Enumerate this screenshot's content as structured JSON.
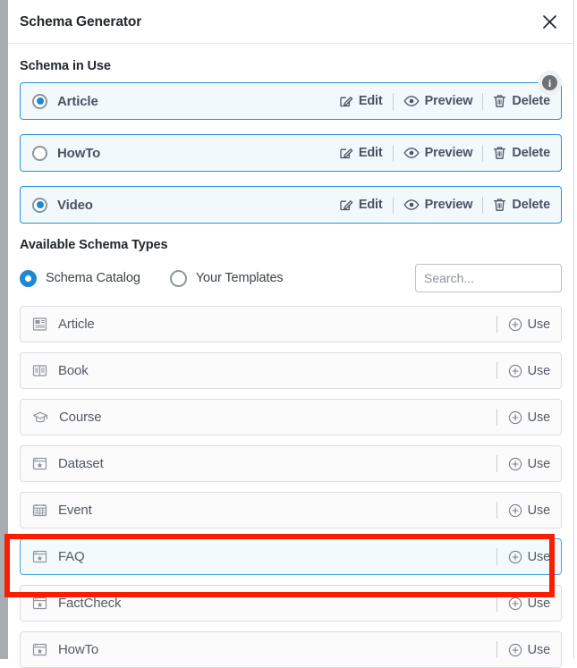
{
  "modal": {
    "title": "Schema Generator",
    "close_icon": "close-icon"
  },
  "schema_in_use": {
    "title": "Schema in Use",
    "info_icon": "info-icon",
    "info_glyph": "i",
    "action_labels": {
      "edit": "Edit",
      "preview": "Preview",
      "delete": "Delete"
    },
    "rows": [
      {
        "name": "Article",
        "selected": true
      },
      {
        "name": "HowTo",
        "selected": false
      },
      {
        "name": "Video",
        "selected": true
      }
    ]
  },
  "available_schema_types": {
    "title": "Available Schema Types",
    "filters": [
      {
        "label": "Schema Catalog",
        "selected": true
      },
      {
        "label": "Your Templates",
        "selected": false
      }
    ],
    "search": {
      "placeholder": "Search...",
      "value": ""
    },
    "use_label": "Use",
    "items": [
      {
        "name": "Article",
        "icon": "newspaper-icon",
        "highlighted": false
      },
      {
        "name": "Book",
        "icon": "open-book-icon",
        "highlighted": false
      },
      {
        "name": "Course",
        "icon": "graduation-cap-icon",
        "highlighted": false
      },
      {
        "name": "Dataset",
        "icon": "window-star-icon",
        "highlighted": false
      },
      {
        "name": "Event",
        "icon": "calendar-grid-icon",
        "highlighted": false
      },
      {
        "name": "FAQ",
        "icon": "window-star-icon",
        "highlighted": true
      },
      {
        "name": "FactCheck",
        "icon": "window-star-icon",
        "highlighted": false
      },
      {
        "name": "HowTo",
        "icon": "window-star-icon",
        "highlighted": false
      }
    ]
  },
  "annotation": {
    "color": "#fa1d00",
    "target": "FAQ"
  }
}
